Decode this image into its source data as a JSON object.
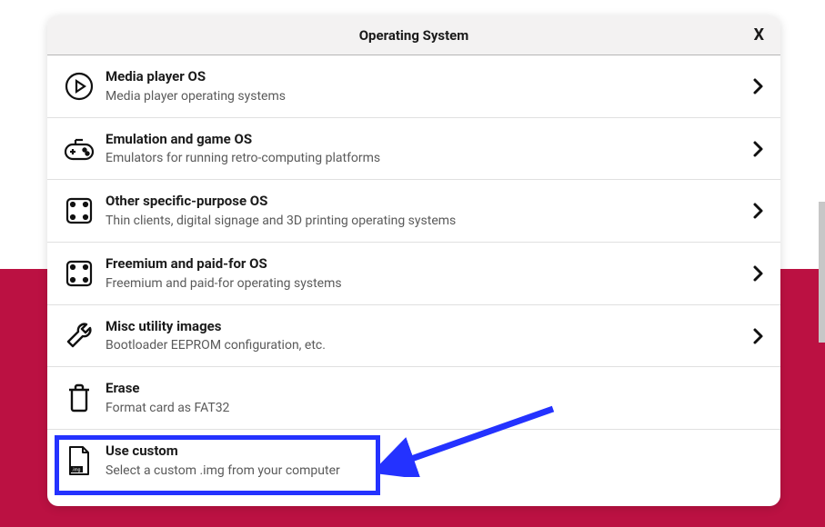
{
  "modal": {
    "title": "Operating System",
    "close": "X"
  },
  "items": [
    {
      "title": "Media player OS",
      "sub": "Media player operating systems",
      "chevron": true
    },
    {
      "title": "Emulation and game OS",
      "sub": "Emulators for running retro-computing platforms",
      "chevron": true
    },
    {
      "title": "Other specific-purpose OS",
      "sub": "Thin clients, digital signage and 3D printing operating systems",
      "chevron": true
    },
    {
      "title": "Freemium and paid-for OS",
      "sub": "Freemium and paid-for operating systems",
      "chevron": true
    },
    {
      "title": "Misc utility images",
      "sub": "Bootloader EEPROM configuration, etc.",
      "chevron": true
    },
    {
      "title": "Erase",
      "sub": "Format card as FAT32",
      "chevron": false
    },
    {
      "title": "Use custom",
      "sub": "Select a custom .img from your computer",
      "chevron": false
    }
  ],
  "annotation": {
    "highlight_color": "#2432ff",
    "arrow_color": "#2432ff"
  }
}
